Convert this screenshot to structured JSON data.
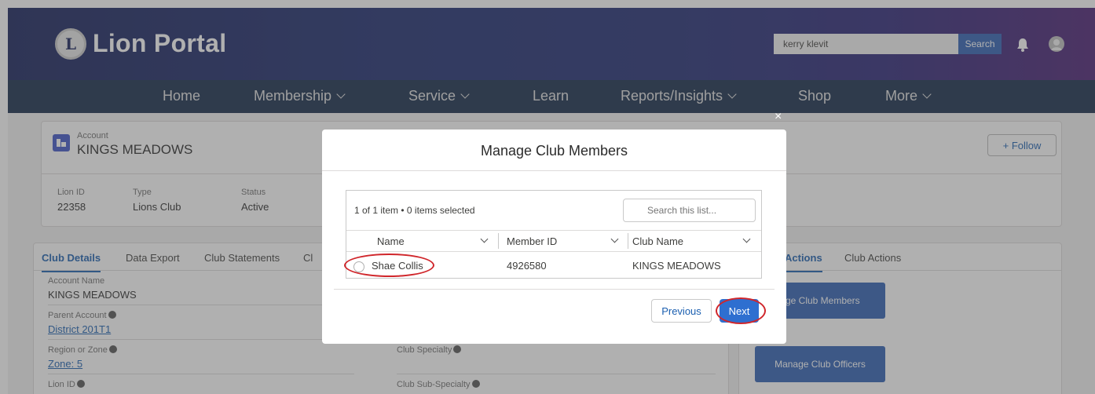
{
  "header": {
    "brand": "Lion Portal",
    "search_value": "kerry klevit",
    "search_button": "Search"
  },
  "nav": {
    "items": [
      {
        "label": "Home"
      },
      {
        "label": "Membership"
      },
      {
        "label": "Service"
      },
      {
        "label": "Learn"
      },
      {
        "label": "Reports/Insights"
      },
      {
        "label": "Shop"
      },
      {
        "label": "More"
      }
    ]
  },
  "account": {
    "type_label": "Account",
    "name": "KINGS MEADOWS",
    "follow_label": "+ Follow",
    "highlights": [
      {
        "label": "Lion ID",
        "value": "22358"
      },
      {
        "label": "Type",
        "value": "Lions Club"
      },
      {
        "label": "Status",
        "value": "Active"
      }
    ]
  },
  "tabs": [
    "Club Details",
    "Data Export",
    "Club Statements",
    "Cl"
  ],
  "fields": {
    "account_name_label": "Account Name",
    "account_name_value": "KINGS MEADOWS",
    "parent_account_label": "Parent Account",
    "parent_account_value": "District 201T1",
    "region_label": "Region or Zone",
    "region_value": "Zone: 5",
    "lion_id_label": "Lion ID",
    "club_specialty_label": "Club Specialty",
    "club_sub_specialty_label": "Club Sub-Specialty"
  },
  "right_panel": {
    "tabs": [
      "Actions",
      "Club Actions"
    ],
    "manage_members_label": "age Club Members",
    "manage_officers_label": "Manage Club Officers"
  },
  "modal": {
    "close": "×",
    "title": "Manage Club Members",
    "count_text": "1 of 1 item • 0 items selected",
    "search_placeholder": "Search this list...",
    "columns": [
      "Name",
      "Member ID",
      "Club Name"
    ],
    "rows": [
      {
        "name": "Shae Collis",
        "member_id": "4926580",
        "club_name": "KINGS MEADOWS"
      }
    ],
    "previous_label": "Previous",
    "next_label": "Next"
  },
  "colors": {
    "header_start": "#15205a",
    "header_end": "#4a1e73",
    "nav_bg": "#142a4a",
    "brand_blue": "#2e5fb3",
    "annotation_red": "#d0262b"
  }
}
